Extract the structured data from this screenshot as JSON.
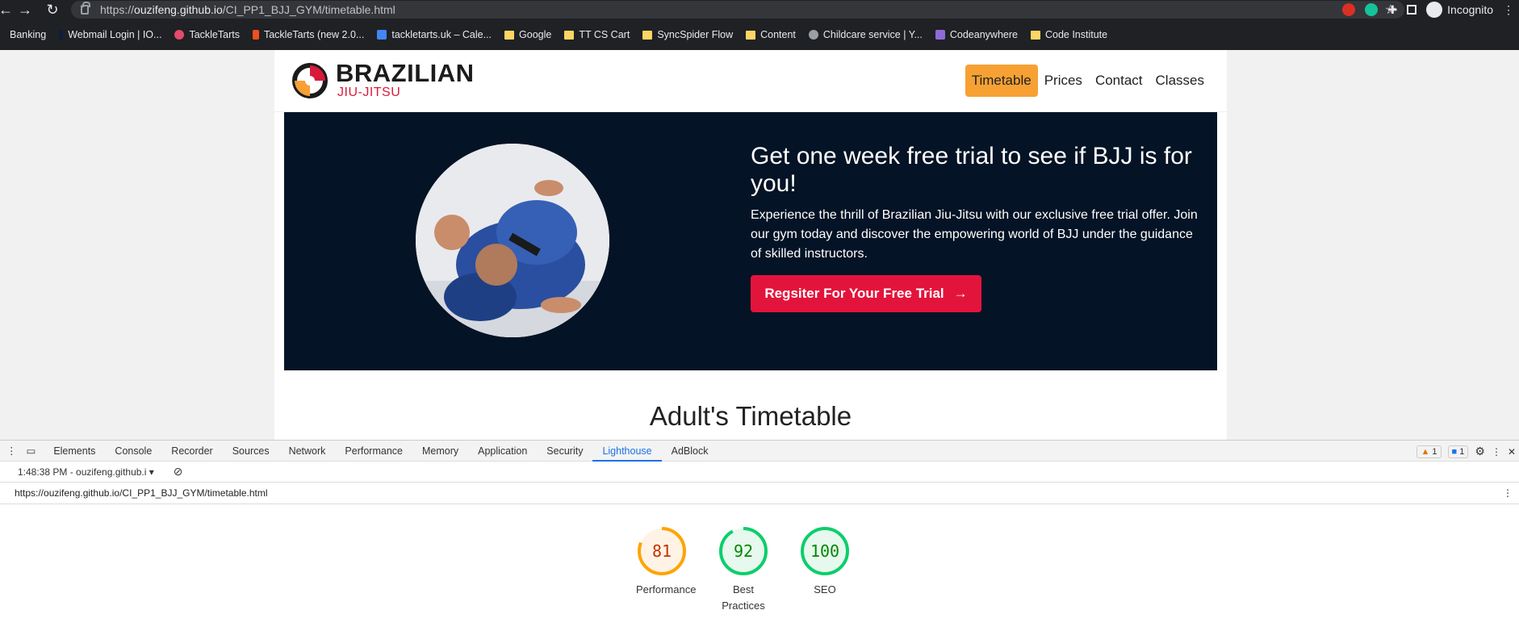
{
  "browser": {
    "url_prefix": "https://",
    "url_host": "ouzifeng.github.io",
    "url_path": "/CI_PP1_BJJ_GYM/timetable.html",
    "incognito_label": "Incognito",
    "bookmarks": [
      "Banking",
      "Webmail Login | IO...",
      "TackleTarts",
      "TackleTarts (new 2.0...",
      "tackletarts.uk – Cale...",
      "Google",
      "TT CS Cart",
      "SyncSpider Flow",
      "Content",
      "Childcare service | Y...",
      "Codeanywhere",
      "Code Institute"
    ]
  },
  "site": {
    "logo_main": "BRAZILIAN",
    "logo_sub": "JIU-JITSU",
    "nav": [
      "Timetable",
      "Prices",
      "Contact",
      "Classes"
    ],
    "hero_title": "Get one week free trial to see if BJJ is for you!",
    "hero_text": "Experience the thrill of Brazilian Jiu-Jitsu with our exclusive free trial offer. Join our gym today and discover the empowering world of BJJ under the guidance of skilled instructors.",
    "cta_label": "Regsiter For Your Free Trial",
    "section_title": "Adult's Timetable",
    "colors": {
      "accent": "#f7a134",
      "brand_red": "#e3143c",
      "hero_bg": "#041325"
    }
  },
  "devtools": {
    "tabs": [
      "Elements",
      "Console",
      "Recorder",
      "Sources",
      "Network",
      "Performance",
      "Memory",
      "Application",
      "Security",
      "Lighthouse",
      "AdBlock"
    ],
    "active_tab": "Lighthouse",
    "warnings_count": "1",
    "messages_count": "1",
    "report_select": "1:48:38 PM - ouzifeng.github.i",
    "report_url": "https://ouzifeng.github.io/CI_PP1_BJJ_GYM/timetable.html",
    "scores": [
      {
        "label": "Performance",
        "value": "81",
        "fraction": 0.81,
        "color": "#ffa400",
        "text_color": "#c33300",
        "bg": "#fff3e6"
      },
      {
        "label": "Best Practices",
        "value": "92",
        "fraction": 0.92,
        "color": "#0cce6b",
        "text_color": "#008800",
        "bg": "#e7f8ee"
      },
      {
        "label": "SEO",
        "value": "100",
        "fraction": 1.0,
        "color": "#0cce6b",
        "text_color": "#008800",
        "bg": "#e7f8ee"
      }
    ]
  }
}
